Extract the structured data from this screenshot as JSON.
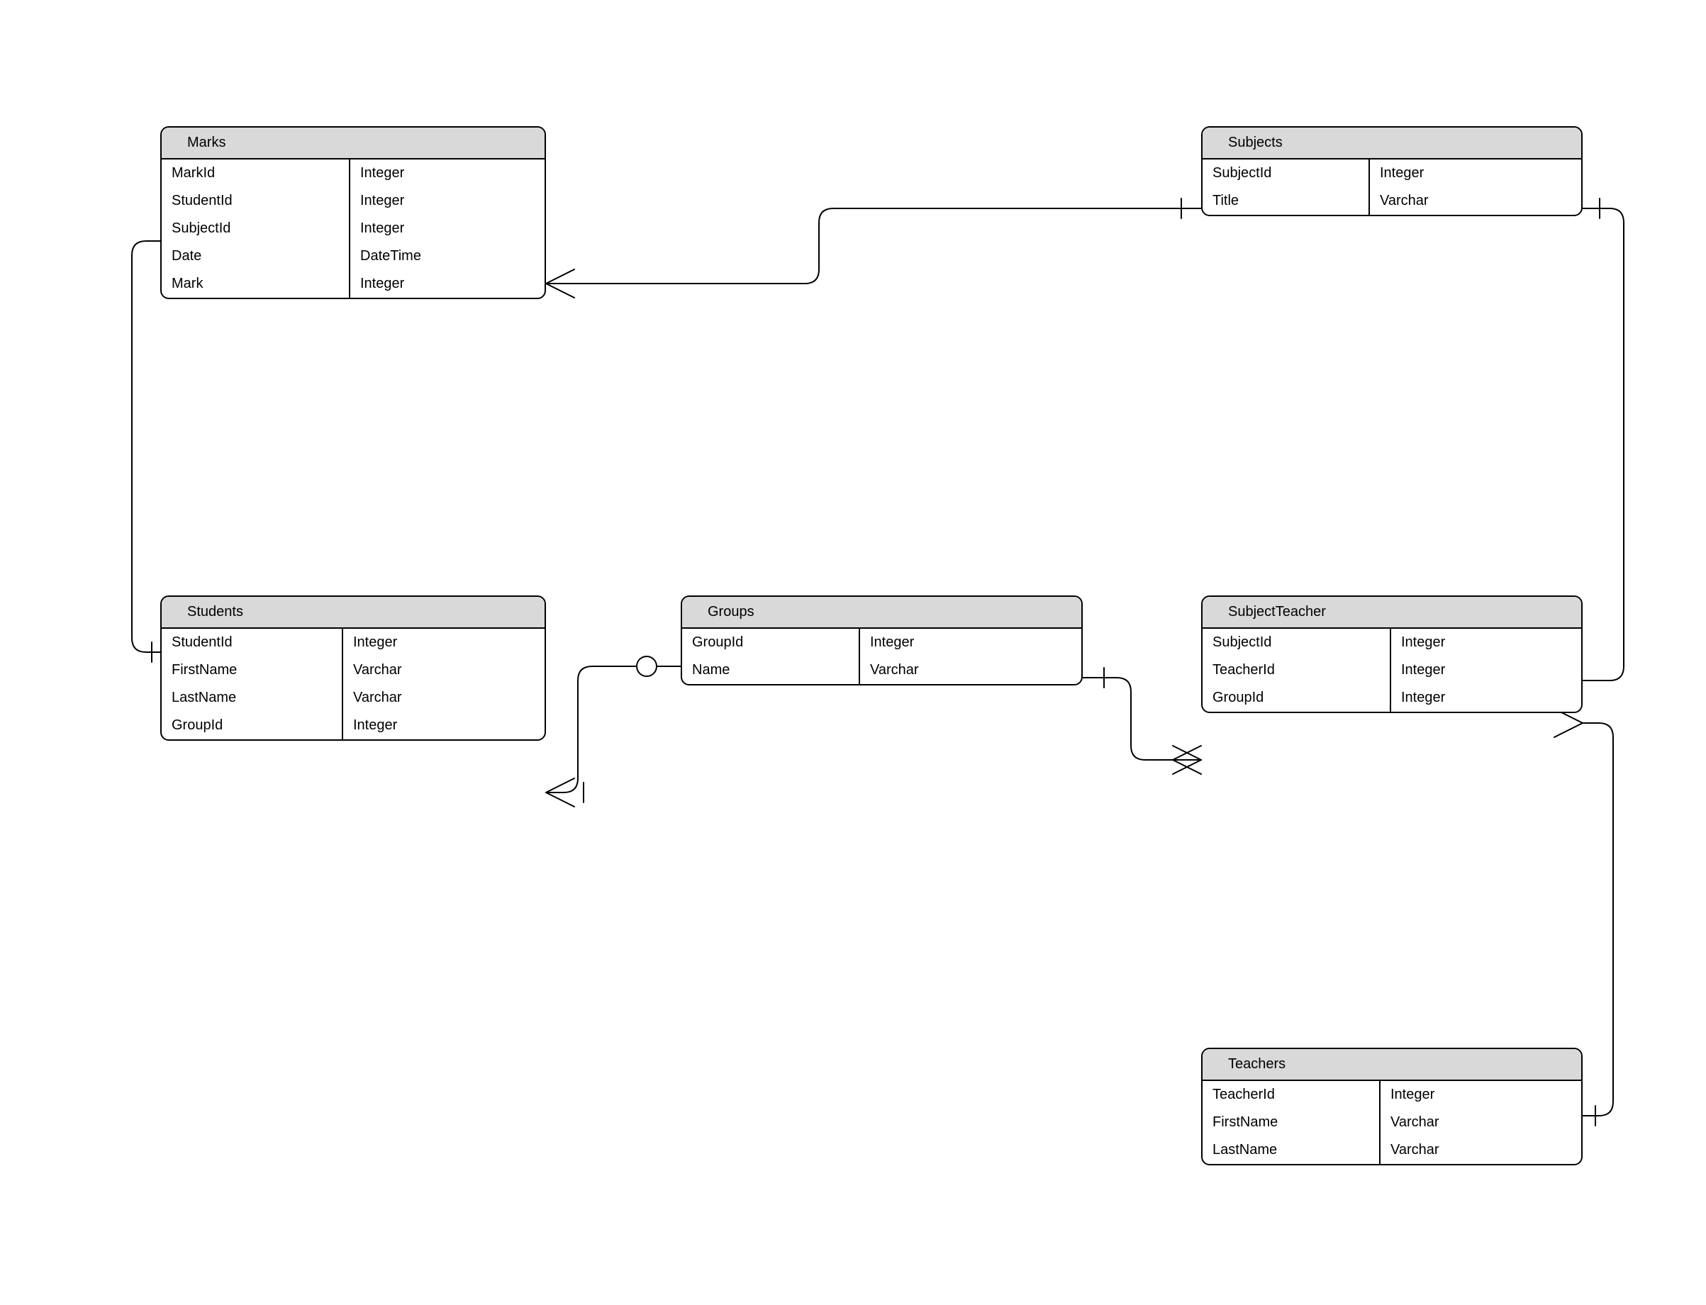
{
  "diagram_type": "Entity-Relationship Diagram (crow's foot)",
  "entities": {
    "marks": {
      "title": "Marks",
      "columns": [
        {
          "name": "MarkId",
          "type": "Integer"
        },
        {
          "name": "StudentId",
          "type": "Integer"
        },
        {
          "name": "SubjectId",
          "type": "Integer"
        },
        {
          "name": "Date",
          "type": "DateTime"
        },
        {
          "name": "Mark",
          "type": "Integer"
        }
      ]
    },
    "students": {
      "title": "Students",
      "columns": [
        {
          "name": "StudentId",
          "type": "Integer"
        },
        {
          "name": "FirstName",
          "type": "Varchar"
        },
        {
          "name": "LastName",
          "type": "Varchar"
        },
        {
          "name": "GroupId",
          "type": "Integer"
        }
      ]
    },
    "groups": {
      "title": "Groups",
      "columns": [
        {
          "name": "GroupId",
          "type": "Integer"
        },
        {
          "name": "Name",
          "type": "Varchar"
        }
      ]
    },
    "subjects": {
      "title": "Subjects",
      "columns": [
        {
          "name": "SubjectId",
          "type": "Integer"
        },
        {
          "name": "Title",
          "type": "Varchar"
        }
      ]
    },
    "subjectteacher": {
      "title": "SubjectTeacher",
      "columns": [
        {
          "name": "SubjectId",
          "type": "Integer"
        },
        {
          "name": "TeacherId",
          "type": "Integer"
        },
        {
          "name": "GroupId",
          "type": "Integer"
        }
      ]
    },
    "teachers": {
      "title": "Teachers",
      "columns": [
        {
          "name": "TeacherId",
          "type": "Integer"
        },
        {
          "name": "FirstName",
          "type": "Varchar"
        },
        {
          "name": "LastName",
          "type": "Varchar"
        }
      ]
    }
  },
  "relationships": [
    {
      "from": "Marks",
      "from_end": "many (crow)",
      "to": "Subjects",
      "to_end": "one (bar)"
    },
    {
      "from": "Marks",
      "from_end": "one-or-many (crow+bar)",
      "to": "Students",
      "to_end": "one (bar)"
    },
    {
      "from": "Students",
      "from_end": "one-or-many (crow+bar)",
      "to": "Groups",
      "to_end": "zero-or-one (circle)"
    },
    {
      "from": "SubjectTeacher",
      "from_end": "many (crow)",
      "to": "Groups",
      "to_end": "one (bar)"
    },
    {
      "from": "SubjectTeacher",
      "from_end": "many (crow)",
      "to": "Subjects",
      "to_end": "one (bar)"
    },
    {
      "from": "SubjectTeacher",
      "from_end": "many (crow)",
      "to": "Teachers",
      "to_end": "one (bar)"
    }
  ]
}
